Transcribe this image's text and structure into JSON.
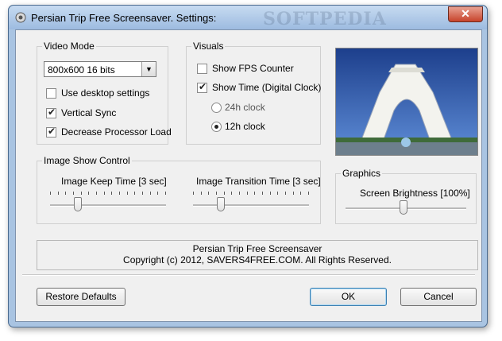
{
  "window": {
    "title": "Persian Trip Free Screensaver. Settings:",
    "watermark": "SOFTPEDIA",
    "close_label": "✕"
  },
  "video_mode": {
    "legend": "Video Mode",
    "resolution": "800x600 16 bits",
    "use_desktop": {
      "label": "Use desktop settings",
      "checked": false
    },
    "vsync": {
      "label": "Vertical Sync",
      "checked": true
    },
    "decrease_load": {
      "label": "Decrease Processor Load",
      "checked": true
    }
  },
  "visuals": {
    "legend": "Visuals",
    "show_fps": {
      "label": "Show FPS Counter",
      "checked": false
    },
    "show_time": {
      "label": "Show Time (Digital Clock)",
      "checked": true
    },
    "clock_24h": {
      "label": "24h clock",
      "selected": false
    },
    "clock_12h": {
      "label": "12h clock",
      "selected": true
    }
  },
  "image_show": {
    "legend": "Image Show Control",
    "keep_time": {
      "label": "Image Keep Time [3 sec]",
      "value": 3
    },
    "transition_time": {
      "label": "Image Transition Time [3 sec]",
      "value": 3
    }
  },
  "graphics": {
    "legend": "Graphics",
    "brightness": {
      "label": "Screen Brightness [100%]",
      "percent": 100
    }
  },
  "info": {
    "line1": "Persian Trip Free Screensaver",
    "line2": "Copyright (c) 2012, SAVERS4FREE.COM. All Rights Reserved."
  },
  "buttons": {
    "restore": "Restore Defaults",
    "ok": "OK",
    "cancel": "Cancel"
  },
  "colors": {
    "accent": "#3c7fb1",
    "close": "#c7432b"
  },
  "icons": {
    "title": "app-icon",
    "preview": "azadi-tower-photo"
  }
}
